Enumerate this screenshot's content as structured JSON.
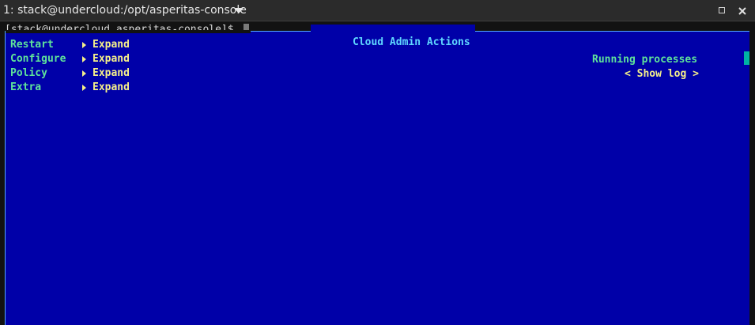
{
  "window": {
    "title": "1: stack@undercloud:/opt/asperitas-console"
  },
  "terminal": {
    "prompt": "[stack@undercloud asperitas-console]$"
  },
  "panel": {
    "title": "Cloud Admin Actions",
    "menu": [
      {
        "label": "Restart",
        "action": "Expand"
      },
      {
        "label": "Configure",
        "action": "Expand"
      },
      {
        "label": "Policy",
        "action": "Expand"
      },
      {
        "label": "Extra",
        "action": "Expand"
      }
    ],
    "running_label": "Running processes",
    "show_log_button": "< Show log >"
  },
  "colors": {
    "panel_bg": "#0000a8",
    "label_green": "#5fe39a",
    "action_yellow": "#f5f08a",
    "title_cyan": "#5fd7ff"
  },
  "icons": {
    "dropdown": "chevron-down-icon",
    "maximize": "maximize-icon",
    "close": "close-icon",
    "expand_arrow": "triangle-right-icon"
  }
}
